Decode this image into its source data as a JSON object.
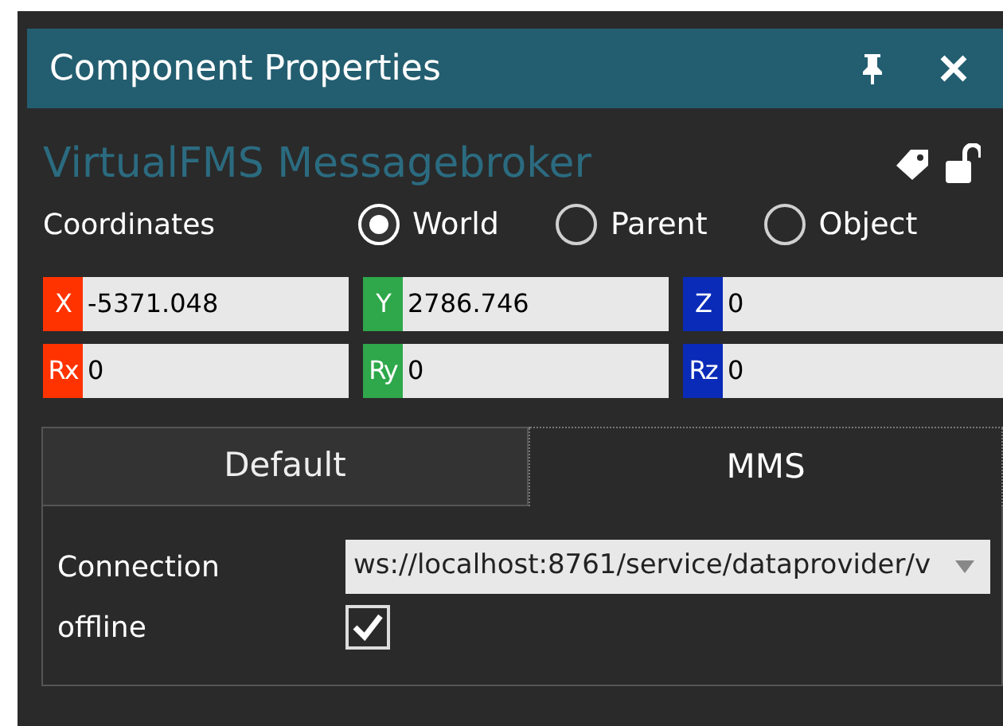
{
  "panel": {
    "title": "Component Properties"
  },
  "component": {
    "name": "VirtualFMS Messagebroker"
  },
  "coordinates": {
    "label": "Coordinates",
    "options": [
      {
        "label": "World",
        "selected": true
      },
      {
        "label": "Parent",
        "selected": false
      },
      {
        "label": "Object",
        "selected": false
      }
    ]
  },
  "fields": [
    {
      "axis": "X",
      "value": "-5371.048",
      "color": "#ff3300"
    },
    {
      "axis": "Y",
      "value": "2786.746",
      "color": "#2ea84a"
    },
    {
      "axis": "Z",
      "value": "0",
      "color": "#0a2bb8"
    },
    {
      "axis": "Rx",
      "value": "0",
      "color": "#ff3300"
    },
    {
      "axis": "Ry",
      "value": "0",
      "color": "#2ea84a"
    },
    {
      "axis": "Rz",
      "value": "0",
      "color": "#0a2bb8"
    }
  ],
  "tabs": [
    {
      "label": "Default",
      "selected": false
    },
    {
      "label": "MMS",
      "selected": true
    }
  ],
  "properties": [
    {
      "kind": "dropdown",
      "label": "Connection",
      "value": "ws://localhost:8761/service/dataprovider/v"
    },
    {
      "kind": "checkbox",
      "label": "offline",
      "checked": true
    }
  ]
}
